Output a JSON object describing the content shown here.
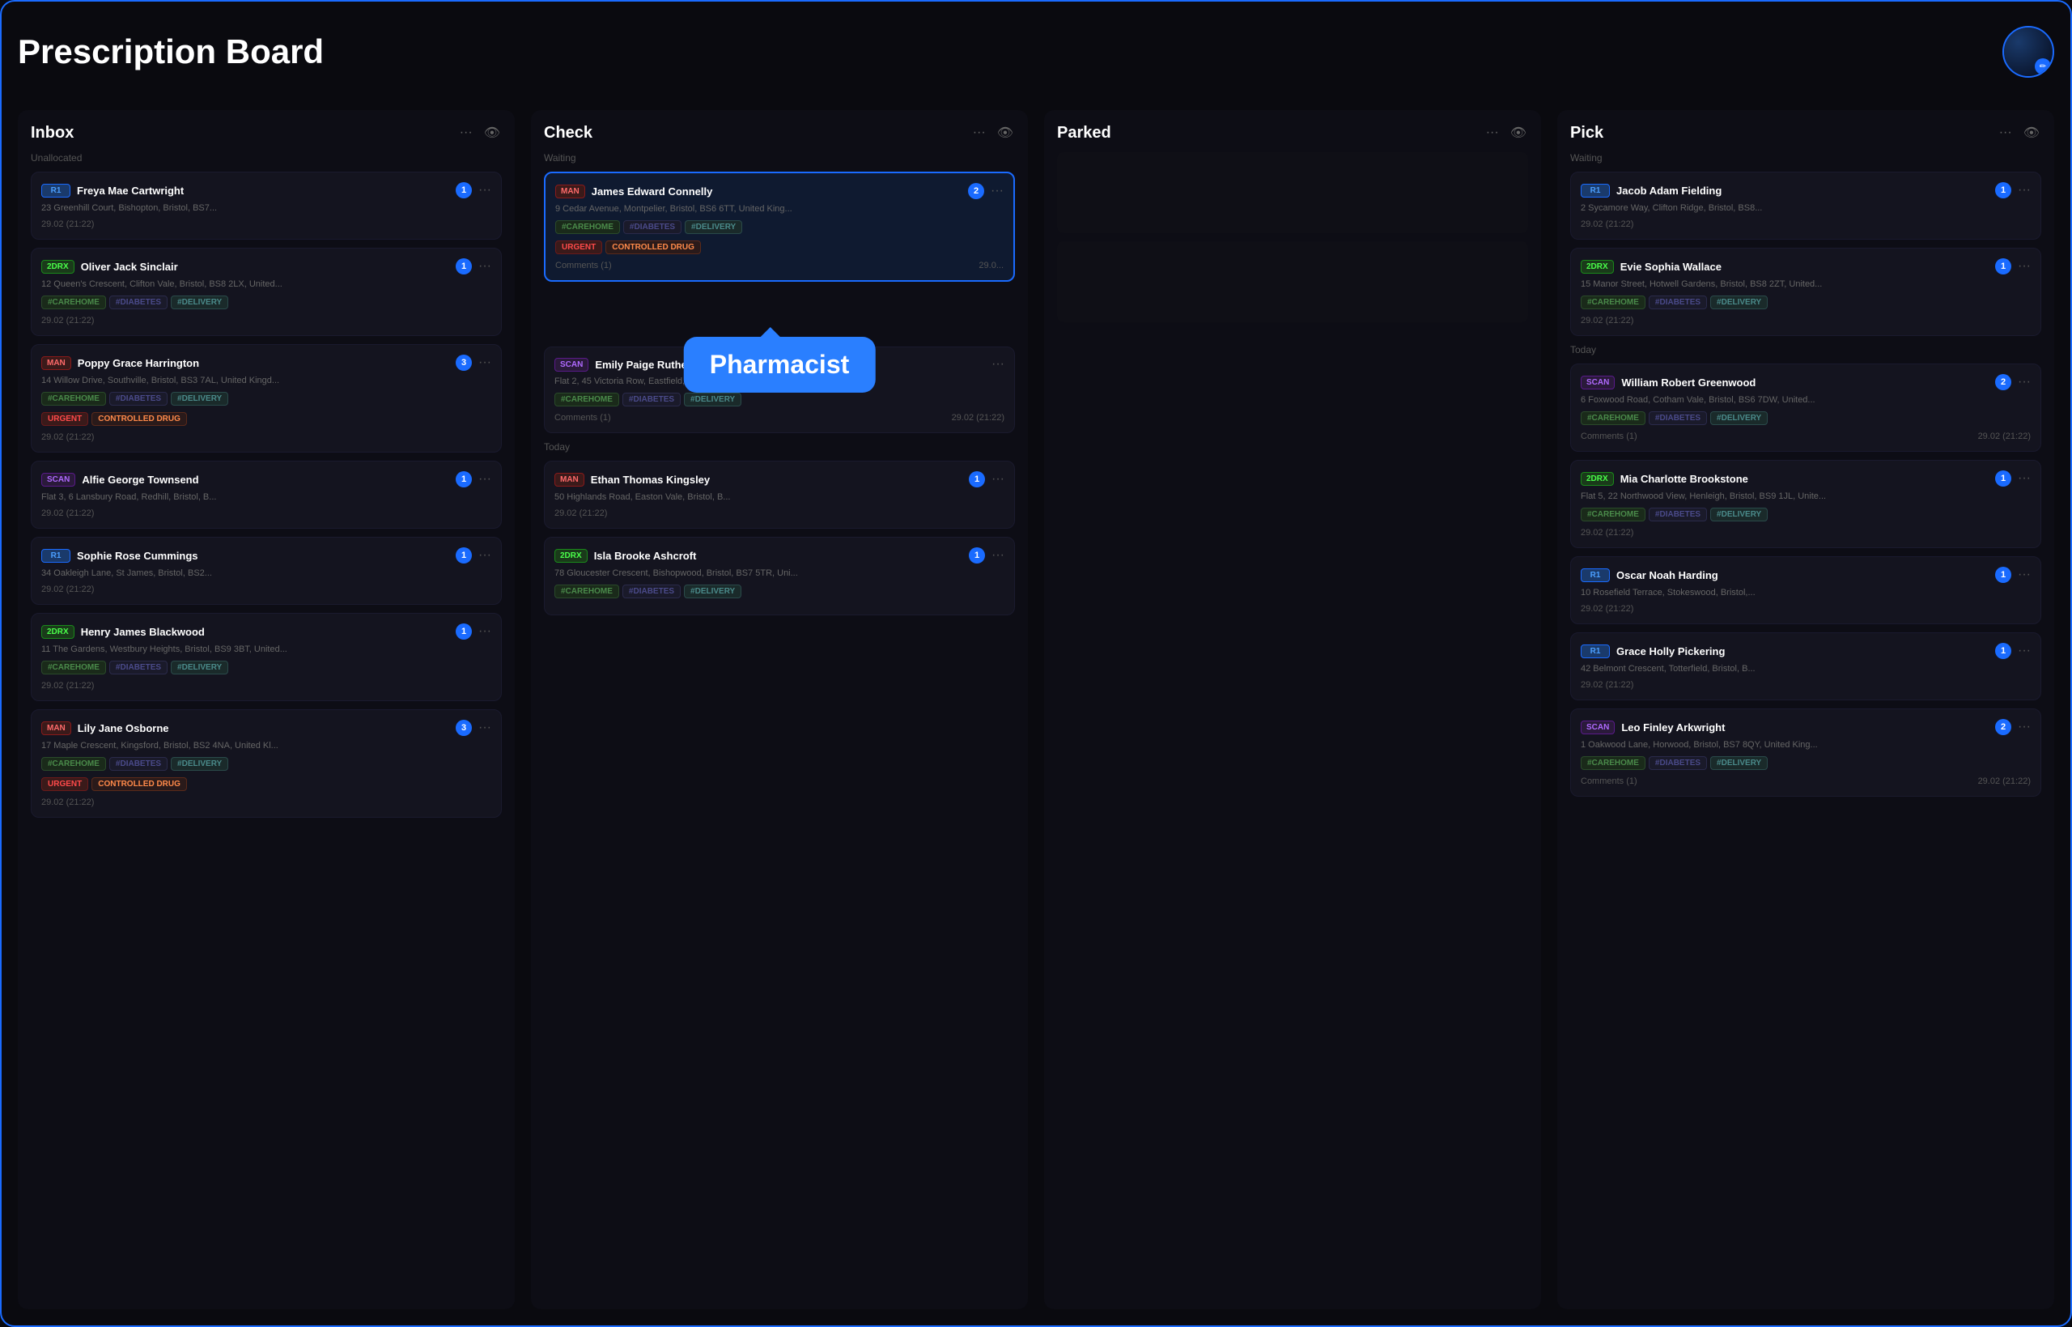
{
  "app": {
    "title": "Prescription Board"
  },
  "columns": [
    {
      "id": "inbox",
      "title": "Inbox",
      "section": "Unallocated",
      "cards": [
        {
          "id": "c1",
          "badge": "R1",
          "badge_type": "r1",
          "name": "Freya Mae Cartwright",
          "address": "23 Greenhill Court, Bishopton, Bristol, BS7...",
          "tags": [
            "#CAREHOME",
            "#DIABETES",
            "#DELIVERY"
          ],
          "extra_tags": [],
          "count": 1,
          "timestamp": "29.02 (21:22)",
          "comments": null
        },
        {
          "id": "c2",
          "badge": "2DRX",
          "badge_type": "2drx",
          "name": "Oliver Jack Sinclair",
          "address": "12 Queen's Crescent, Clifton Vale, Bristol, BS8 2LX, United...",
          "tags": [
            "#CAREHOME",
            "#DIABETES",
            "#DELIVERY"
          ],
          "extra_tags": [],
          "count": 1,
          "timestamp": "29.02 (21:22)",
          "comments": null
        },
        {
          "id": "c3",
          "badge": "MAN",
          "badge_type": "man",
          "name": "Poppy Grace Harrington",
          "address": "14 Willow Drive, Southville, Bristol, BS3 7AL, United Kingd...",
          "tags": [
            "#CAREHOME",
            "#DIABETES",
            "#DELIVERY"
          ],
          "extra_tags": [
            "URGENT",
            "CONTROLLED DRUG"
          ],
          "count": 3,
          "timestamp": "29.02 (21:22)",
          "comments": null
        },
        {
          "id": "c4",
          "badge": "SCAN",
          "badge_type": "scan",
          "name": "Alfie George Townsend",
          "address": "Flat 3, 6 Lansbury Road, Redhill, Bristol, B...",
          "tags": [],
          "extra_tags": [],
          "count": 1,
          "timestamp": "29.02 (21:22)",
          "comments": null
        },
        {
          "id": "c5",
          "badge": "R1",
          "badge_type": "r1",
          "name": "Sophie Rose Cummings",
          "address": "34 Oakleigh Lane, St James, Bristol, BS2...",
          "tags": [],
          "extra_tags": [],
          "count": 1,
          "timestamp": "29.02 (21:22)",
          "comments": null
        },
        {
          "id": "c6",
          "badge": "2DRX",
          "badge_type": "2drx",
          "name": "Henry James Blackwood",
          "address": "11 The Gardens, Westbury Heights, Bristol, BS9 3BT, United...",
          "tags": [
            "#CAREHOME",
            "#DIABETES",
            "#DELIVERY"
          ],
          "extra_tags": [],
          "count": 1,
          "timestamp": "29.02 (21:22)",
          "comments": null
        },
        {
          "id": "c7",
          "badge": "MAN",
          "badge_type": "man",
          "name": "Lily Jane Osborne",
          "address": "17 Maple Crescent, Kingsford, Bristol, BS2 4NA, United Kl...",
          "tags": [
            "#CAREHOME",
            "#DIABETES",
            "#DELIVERY"
          ],
          "extra_tags": [
            "URGENT",
            "CONTROLLED DRUG"
          ],
          "count": 3,
          "timestamp": "29.02 (21:22)",
          "comments": null
        }
      ]
    },
    {
      "id": "check",
      "title": "Check",
      "section_waiting": "Waiting",
      "section_today": "Today",
      "waiting_cards": [
        {
          "id": "ch1",
          "badge": "MAN",
          "badge_type": "man",
          "name": "James Edward Connelly",
          "address": "9 Cedar Avenue, Montpelier, Bristol, BS6 6TT, United King...",
          "tags": [
            "#CAREHOME",
            "#DIABETES",
            "#DELIVERY"
          ],
          "extra_tags": [
            "URGENT",
            "CONTROLLED DRUG"
          ],
          "count": 2,
          "timestamp": "29.0...",
          "comments": "Comments (1)",
          "selected": true
        },
        {
          "id": "ch2",
          "badge": "SCAN",
          "badge_type": "scan",
          "name": "Emily Paige Rutherford",
          "address": "Flat 2, 45 Victoria Row, Eastfield, Bristol, BS5 9TD, United...",
          "tags": [
            "#CAREHOME",
            "#DIABETES",
            "#DELIVERY"
          ],
          "extra_tags": [],
          "count": null,
          "timestamp": "29.02 (21:22)",
          "comments": "Comments (1)",
          "selected": false
        }
      ],
      "today_cards": [
        {
          "id": "ch3",
          "badge": "MAN",
          "badge_type": "man",
          "name": "Ethan Thomas Kingsley",
          "address": "50 Highlands Road, Easton Vale, Bristol, B...",
          "tags": [],
          "extra_tags": [],
          "count": 1,
          "timestamp": "29.02 (21:22)",
          "comments": null
        },
        {
          "id": "ch4",
          "badge": "2DRX",
          "badge_type": "2drx",
          "name": "Isla Brooke Ashcroft",
          "address": "78 Gloucester Crescent, Bishopwood, Bristol, BS7 5TR, Uni...",
          "tags": [
            "#CAREHOME",
            "#DIABETES",
            "#DELIVERY"
          ],
          "extra_tags": [],
          "count": 1,
          "timestamp": "",
          "comments": null
        }
      ]
    },
    {
      "id": "parked",
      "title": "Parked",
      "cards": []
    },
    {
      "id": "pick",
      "title": "Pick",
      "section_waiting": "Waiting",
      "section_today": "Today",
      "waiting_cards": [
        {
          "id": "p1",
          "badge": "R1",
          "badge_type": "r1",
          "name": "Jacob Adam Fielding",
          "address": "2 Sycamore Way, Clifton Ridge, Bristol, BS8...",
          "tags": [],
          "extra_tags": [],
          "count": 1,
          "timestamp": "29.02 (21:22)",
          "comments": null
        },
        {
          "id": "p2",
          "badge": "2DRX",
          "badge_type": "2drx",
          "name": "Evie Sophia Wallace",
          "address": "15 Manor Street, Hotwell Gardens, Bristol, BS8 2ZT, United...",
          "tags": [
            "#CAREHOME",
            "#DIABETES",
            "#DELIVERY"
          ],
          "extra_tags": [],
          "count": 1,
          "timestamp": "29.02 (21:22)",
          "comments": null
        }
      ],
      "today_cards": [
        {
          "id": "p3",
          "badge": "SCAN",
          "badge_type": "scan",
          "name": "William Robert Greenwood",
          "address": "6 Foxwood Road, Cotham Vale, Bristol, BS6 7DW, United...",
          "tags": [
            "#CAREHOME",
            "#DIABETES",
            "#DELIVERY"
          ],
          "extra_tags": [],
          "count": 2,
          "timestamp": "29.02 (21:22)",
          "comments": "Comments (1)"
        },
        {
          "id": "p4",
          "badge": "2DRX",
          "badge_type": "2drx",
          "name": "Mia Charlotte Brookstone",
          "address": "Flat 5, 22 Northwood View, Henleigh, Bristol, BS9 1JL, Unite...",
          "tags": [
            "#CAREHOME",
            "#DIABETES",
            "#DELIVERY"
          ],
          "extra_tags": [],
          "count": 1,
          "timestamp": "29.02 (21:22)",
          "comments": null
        },
        {
          "id": "p5",
          "badge": "R1",
          "badge_type": "r1",
          "name": "Oscar Noah Harding",
          "address": "10 Rosefield Terrace, Stokeswood, Bristol,...",
          "tags": [],
          "extra_tags": [],
          "count": 1,
          "timestamp": "29.02 (21:22)",
          "comments": null
        },
        {
          "id": "p6",
          "badge": "R1",
          "badge_type": "r1",
          "name": "Grace Holly Pickering",
          "address": "42 Belmont Crescent, Totterfield, Bristol, B...",
          "tags": [],
          "extra_tags": [],
          "count": 1,
          "timestamp": "29.02 (21:22)",
          "comments": null
        },
        {
          "id": "p7",
          "badge": "SCAN",
          "badge_type": "scan",
          "name": "Leo Finley Arkwright",
          "address": "1 Oakwood Lane, Horwood, Bristol, BS7 8QY, United King...",
          "tags": [
            "#CAREHOME",
            "#DIABETES",
            "#DELIVERY"
          ],
          "extra_tags": [],
          "count": 2,
          "timestamp": "29.02 (21:22)",
          "comments": "Comments (1)"
        }
      ]
    }
  ],
  "tooltip": {
    "text": "Pharmacist"
  },
  "icons": {
    "dots": "···",
    "eye": "👁",
    "edit": "✏"
  }
}
